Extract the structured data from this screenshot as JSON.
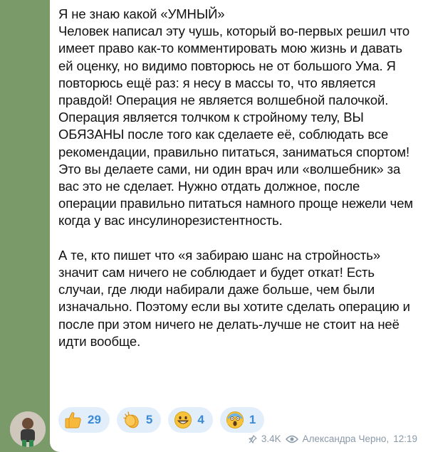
{
  "message": {
    "text": "Я не знаю какой «УМНЫЙ»\nЧеловек написал эту чушь, который во-первых решил что имеет право как-то комментировать мою жизнь и давать ей оценку, но видимо повторюсь не от большого Ума. Я повторюсь ещё раз: я несу в массы то, что является правдой! Операция не является волшебной палочкой. Операция является толчком к стройному телу, ВЫ ОБЯЗАНЫ после того как сделаете её, соблюдать все рекомендации, правильно питаться, заниматься спортом! Это вы делаете сами, ни один врач или «волшебник» за вас это не сделает. Нужно отдать должное, после операции правильно питаться намного проще нежели чем когда у вас инсулинорезистентность.\n\nА те, кто пишет что «я забираю шанс на стройность» значит сам ничего не соблюдает и будет откат! Есть случаи, где люди набирали даже больше, чем были изначально. Поэтому если вы хотите сделать операцию и после при этом ничего не делать-лучше не стоит на неё идти вообще.",
    "reactions": [
      {
        "emoji": "thumbs-up",
        "count": "29"
      },
      {
        "emoji": "clapping-hands",
        "count": "5"
      },
      {
        "emoji": "grinning-face",
        "count": "4"
      },
      {
        "emoji": "screaming-face",
        "count": "1"
      }
    ],
    "meta": {
      "views": "3.4K",
      "author": "Александра Черно",
      "time": "12:19"
    }
  },
  "colors": {
    "background": "#7a9a6a",
    "bubble": "#ffffff",
    "reaction_bg": "#e3eefb",
    "reaction_count": "#3a8ad6",
    "meta": "#8a99a8"
  }
}
